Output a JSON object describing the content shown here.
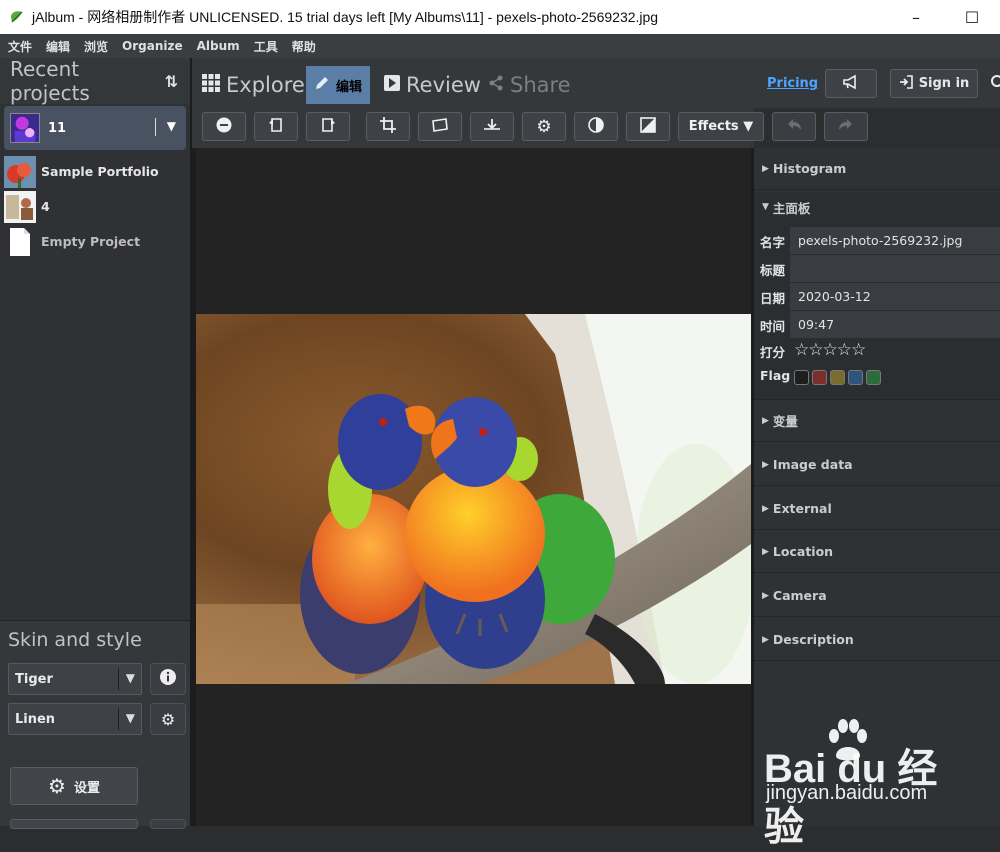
{
  "window": {
    "title": "jAlbum - 网络相册制作者 UNLICENSED. 15 trial days left [My Albums\\11] - pexels-photo-2569232.jpg",
    "minimize_glyph": "–",
    "maximize_glyph": "☐"
  },
  "menubar": [
    "文件",
    "编辑",
    "浏览",
    "Organize",
    "Album",
    "工具",
    "帮助"
  ],
  "left": {
    "header": "Recent projects",
    "current_project": "11",
    "projects": [
      {
        "name": "Sample Portfolio"
      },
      {
        "name": "4"
      },
      {
        "name": "Empty Project"
      }
    ],
    "skin_title": "Skin and style",
    "skin": "Tiger",
    "style": "Linen",
    "settings_label": "设置"
  },
  "tabs": {
    "explore": "Explore",
    "edit": "编辑",
    "review": "Review",
    "share": "Share",
    "pricing": "Pricing",
    "sign_in": "Sign in"
  },
  "toolbar": {
    "effects": "Effects ▼",
    "tools": [
      "remove-icon",
      "rotate-left-icon",
      "rotate-right-icon",
      "crop-icon",
      "straighten-icon",
      "upload-icon",
      "settings-icon",
      "contrast-icon",
      "exposure-icon",
      "undo-icon",
      "redo-icon"
    ]
  },
  "right": {
    "sections": {
      "histogram": "Histogram",
      "main": "主面板",
      "variables": "变量",
      "image_data": "Image data",
      "external": "External",
      "location": "Location",
      "camera": "Camera",
      "description": "Description"
    },
    "props": {
      "name_label": "名字",
      "name_value": "pexels-photo-2569232.jpg",
      "title_label": "标题",
      "title_value": "",
      "date_label": "日期",
      "date_value": "2020-03-12",
      "time_label": "时间",
      "time_value": "09:47",
      "rating_label": "打分",
      "rating_stars": "☆☆☆☆☆",
      "rating": 0,
      "flag_label": "Flag",
      "flag_colors": [
        "#1e1e1e",
        "#7a2e2e",
        "#7a6b2e",
        "#2e5580",
        "#2f6b3a"
      ]
    }
  },
  "watermark": {
    "main": "Bai du 经验",
    "sub": "jingyan.baidu.com"
  },
  "colors": {
    "accent": "#5a7ea6",
    "link": "#4ea3ff"
  }
}
